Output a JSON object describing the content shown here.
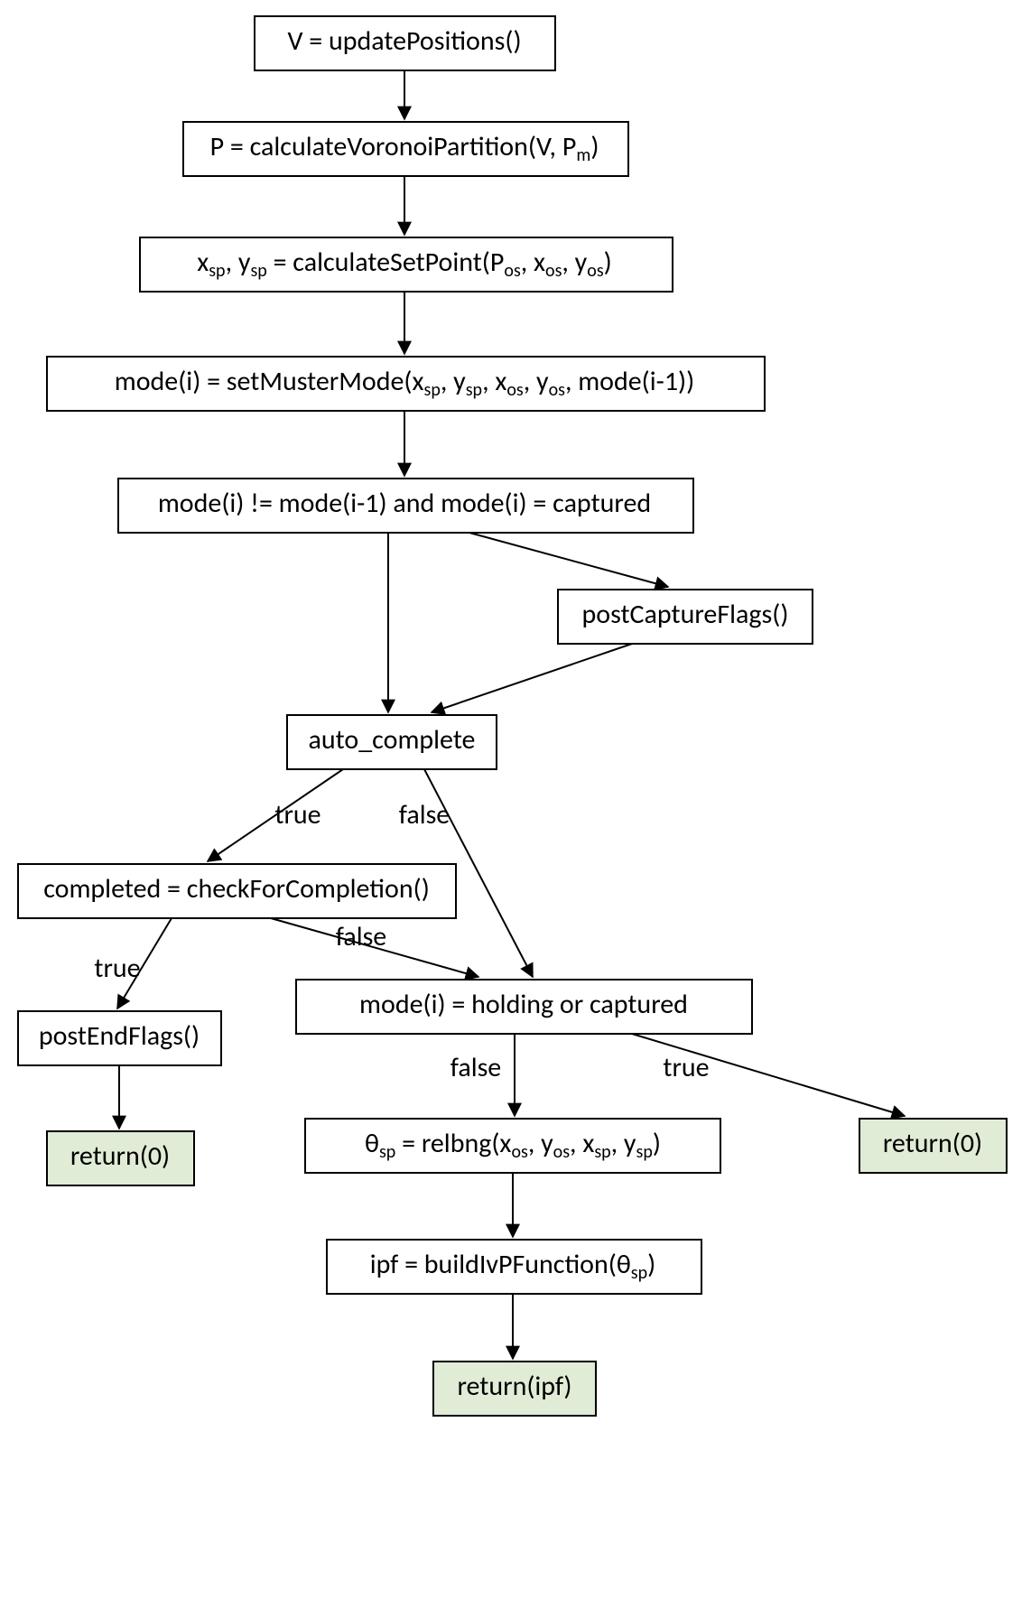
{
  "nodes": {
    "n1": "V = updatePositions()",
    "n2_pre": "P = calculateVoronoiPartition(V, P",
    "n2_sub": "m",
    "n2_post": ")",
    "n3_a": "x",
    "n3_b": ", y",
    "n3_c": " = calculateSetPoint(P",
    "n3_d": ", x",
    "n3_e": ", y",
    "n3_f": ")",
    "n3_sub_sp": "sp",
    "n3_sub_os": "os",
    "n4_a": "mode(i) = setMusterMode(x",
    "n4_b": ", y",
    "n4_c": ", x",
    "n4_d": ", y",
    "n4_e": ", mode(i-1))",
    "n4_sub_sp": "sp",
    "n4_sub_os": "os",
    "n5": "mode(i) != mode(i-1) and mode(i) = captured",
    "n6": "postCaptureFlags()",
    "n7": "auto_complete",
    "n8": "completed = checkForCompletion()",
    "n9": "postEndFlags()",
    "n10": "return(0)",
    "n11": "mode(i) = holding or captured",
    "n12_a": "θ",
    "n12_b": " = relbng(x",
    "n12_c": ", y",
    "n12_d": ", x",
    "n12_e": ", y",
    "n12_f": ")",
    "n12_sub_sp": "sp",
    "n12_sub_os": "os",
    "n13_a": "ipf = buildIvPFunction(θ",
    "n13_b": ")",
    "n13_sub_sp": "sp",
    "n14": "return(ipf)",
    "n15": "return(0)"
  },
  "edges": {
    "true": "true",
    "false": "false"
  }
}
